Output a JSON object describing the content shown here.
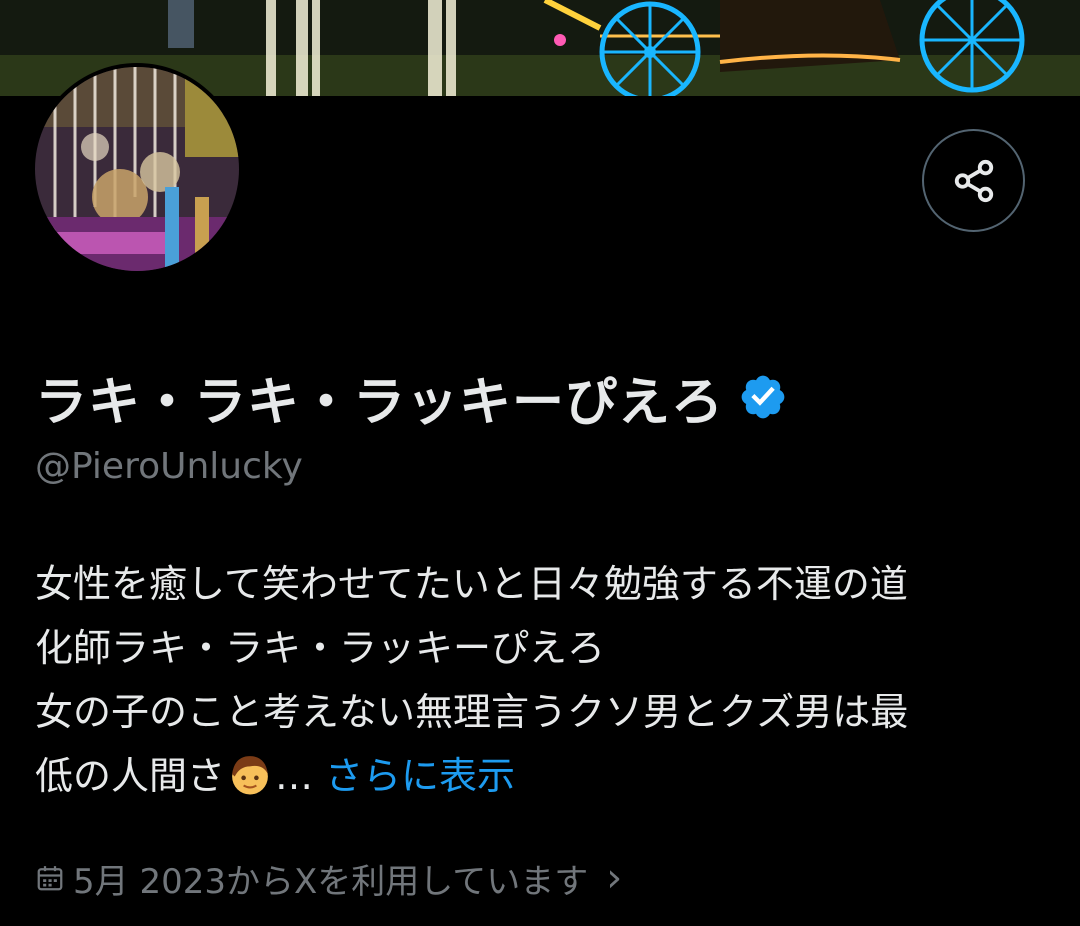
{
  "profile": {
    "display_name": "ラキ・ラキ・ラッキーぴえろ",
    "handle": "@PieroUnlucky",
    "verified_icon": "verified-badge-icon",
    "bio_lines": [
      "女性を癒して笑わせてたいと日々勉強する不運の道",
      "化師ラキ・ラキ・ラッキーぴえろ",
      "女の子のこと考えない無理言うクソ男とクズ男は最",
      "低の人間さ"
    ],
    "bio_ellipsis": "…",
    "show_more": "さらに表示",
    "joined": "5月 2023からXを利用しています",
    "joined_chevron": "›"
  },
  "icons": {
    "share": "share-icon",
    "calendar": "calendar-icon",
    "emoji": "boy-emoji-icon"
  },
  "colors": {
    "background": "#000000",
    "primary_text": "#e7e9ea",
    "secondary_text": "#71767b",
    "link": "#1d9bf0",
    "verified": "#1d9bf0"
  }
}
